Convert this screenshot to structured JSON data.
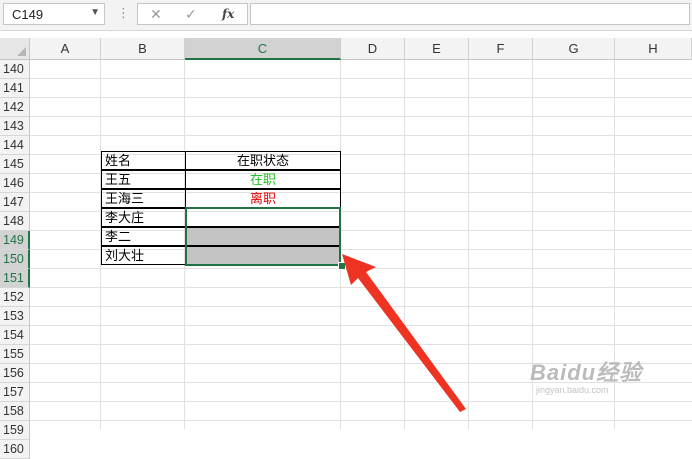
{
  "formula_bar": {
    "name_box": "C149",
    "cancel_icon": "✕",
    "confirm_icon": "✓",
    "fx_label": "fx",
    "formula_value": ""
  },
  "columns": [
    "A",
    "B",
    "C",
    "D",
    "E",
    "F",
    "G",
    "H"
  ],
  "selected_column": "C",
  "rows": [
    "140",
    "141",
    "142",
    "143",
    "144",
    "145",
    "146",
    "147",
    "148",
    "149",
    "150",
    "151",
    "152",
    "153",
    "154",
    "155",
    "156",
    "157",
    "158",
    "159",
    "160"
  ],
  "selected_rows": [
    "149",
    "150",
    "151"
  ],
  "table": {
    "headers": [
      "姓名",
      "在职状态"
    ],
    "rows": [
      {
        "name": "王五",
        "status": "在职"
      },
      {
        "name": "王海三",
        "status": "离职"
      },
      {
        "name": "李大庄",
        "status": ""
      },
      {
        "name": "李二",
        "status": ""
      },
      {
        "name": "刘大壮",
        "status": ""
      }
    ]
  },
  "colors": {
    "accent_green": "#217346",
    "status_active": "#22c022",
    "status_left": "#e00000",
    "arrow_red": "#ee3322",
    "fill_gray": "#c4c4c4"
  },
  "watermark": {
    "line1": "Baidu经验",
    "line2": "jingyan.baidu.com"
  }
}
